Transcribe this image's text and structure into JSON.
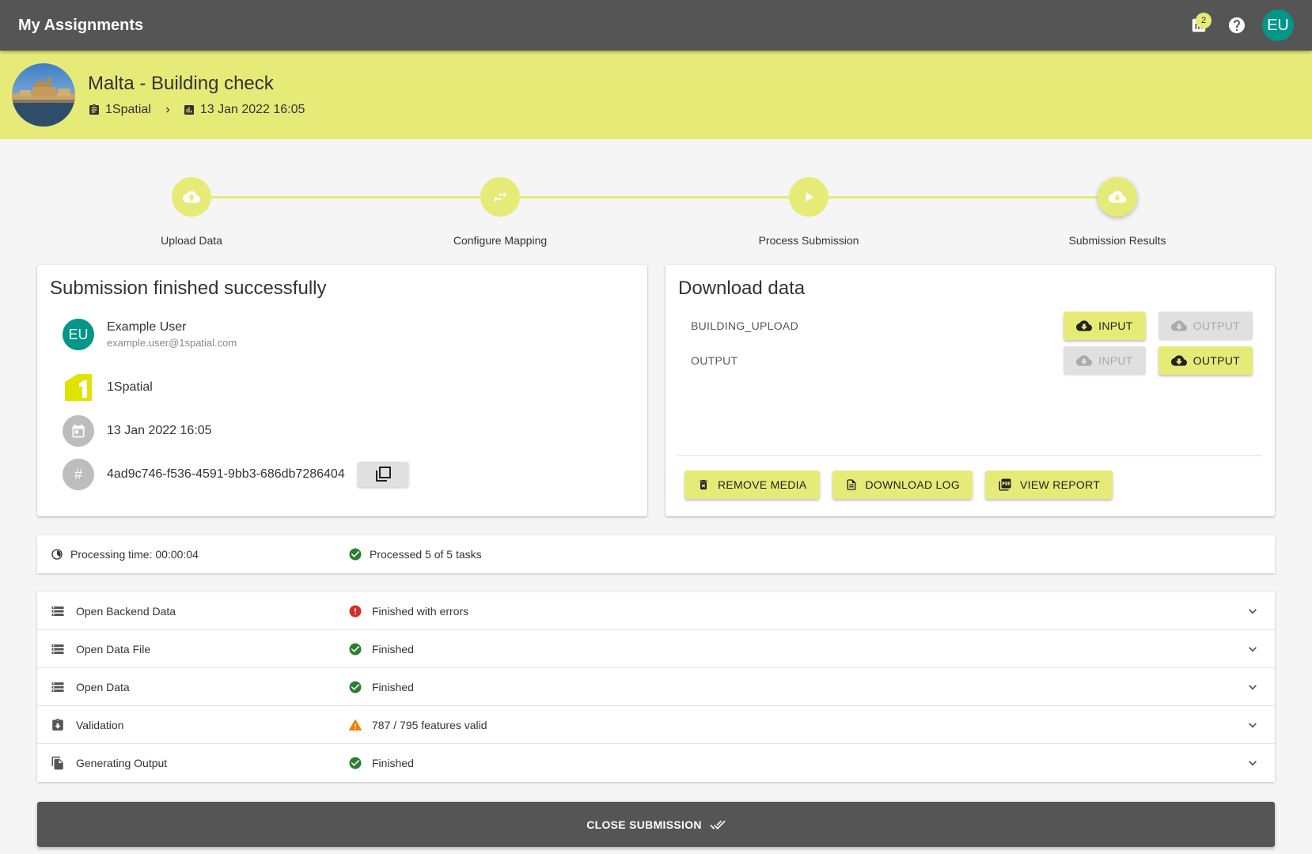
{
  "appbar": {
    "title": "My Assignments",
    "notification_count": "2",
    "user_initials": "EU",
    "icons": [
      "chart-icon",
      "help-icon"
    ]
  },
  "header": {
    "title": "Malta - Building check",
    "organisation": "1Spatial",
    "datetime": "13 Jan 2022 16:05"
  },
  "stepper": {
    "steps": [
      {
        "label": "Upload Data",
        "icon": "cloud-upload-icon"
      },
      {
        "label": "Configure Mapping",
        "icon": "swap-icon"
      },
      {
        "label": "Process Submission",
        "icon": "play-icon"
      },
      {
        "label": "Submission Results",
        "icon": "cloud-download-icon"
      }
    ],
    "active_step": 3
  },
  "submission": {
    "title": "Submission finished successfully",
    "user_initials": "EU",
    "user_name": "Example User",
    "user_email": "example.user@1spatial.com",
    "organisation": "1Spatial",
    "datetime": "13 Jan 2022 16:05",
    "id_symbol": "#",
    "submission_id": "4ad9c746-f536-4591-9bb3-686db7286404"
  },
  "download": {
    "title": "Download data",
    "rows": [
      {
        "name": "BUILDING_UPLOAD",
        "input_label": "INPUT",
        "output_label": "OUTPUT",
        "input_enabled": true,
        "output_enabled": false
      },
      {
        "name": "OUTPUT",
        "input_label": "INPUT",
        "output_label": "OUTPUT",
        "input_enabled": false,
        "output_enabled": true
      }
    ],
    "actions": {
      "remove_media": "REMOVE MEDIA",
      "download_log": "DOWNLOAD LOG",
      "view_report": "VIEW REPORT"
    }
  },
  "summary": {
    "processing_time": "Processing time: 00:00:04",
    "processed": "Processed 5 of 5 tasks"
  },
  "tasks": [
    {
      "name": "Open Backend Data",
      "status": "Finished with errors",
      "status_type": "error"
    },
    {
      "name": "Open Data File",
      "status": "Finished",
      "status_type": "success"
    },
    {
      "name": "Open Data",
      "status": "Finished",
      "status_type": "success"
    },
    {
      "name": "Validation",
      "status": "787 / 795 features valid",
      "status_type": "warning"
    },
    {
      "name": "Generating Output",
      "status": "Finished",
      "status_type": "success"
    }
  ],
  "close_label": "CLOSE SUBMISSION",
  "colors": {
    "accent": "#e6eb78",
    "appbar": "#555555",
    "avatar": "#009688",
    "success": "#2e7d32",
    "error": "#d32f2f",
    "warning": "#ef7d00"
  }
}
